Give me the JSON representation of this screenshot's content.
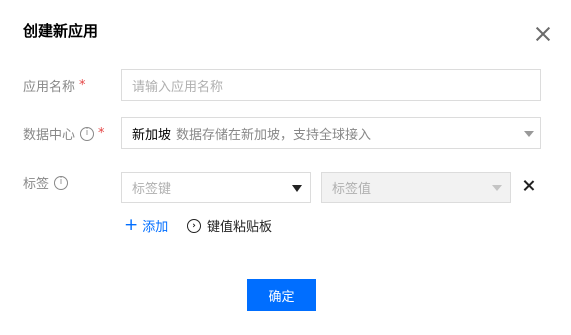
{
  "dialog": {
    "title": "创建新应用",
    "close_icon": "close-icon"
  },
  "form": {
    "app_name": {
      "label": "应用名称",
      "required_mark": "*",
      "placeholder": "请输入应用名称",
      "value": ""
    },
    "data_center": {
      "label": "数据中心",
      "info_icon": "info-icon",
      "required_mark": "*",
      "selected": "新加坡",
      "description": "数据存储在新加坡，支持全球接入"
    },
    "tags": {
      "label": "标签",
      "info_icon": "info-icon",
      "key_placeholder": "标签键",
      "value_placeholder": "标签值",
      "delete_icon": "close-icon"
    },
    "add_label": "添加",
    "add_icon": "plus-icon",
    "paste_label": "键值粘贴板",
    "paste_icon": "chevron-right-circle-icon"
  },
  "footer": {
    "confirm_label": "确定"
  },
  "colors": {
    "accent": "#006eff",
    "required": "#e54545",
    "border": "#dcdcdc"
  }
}
